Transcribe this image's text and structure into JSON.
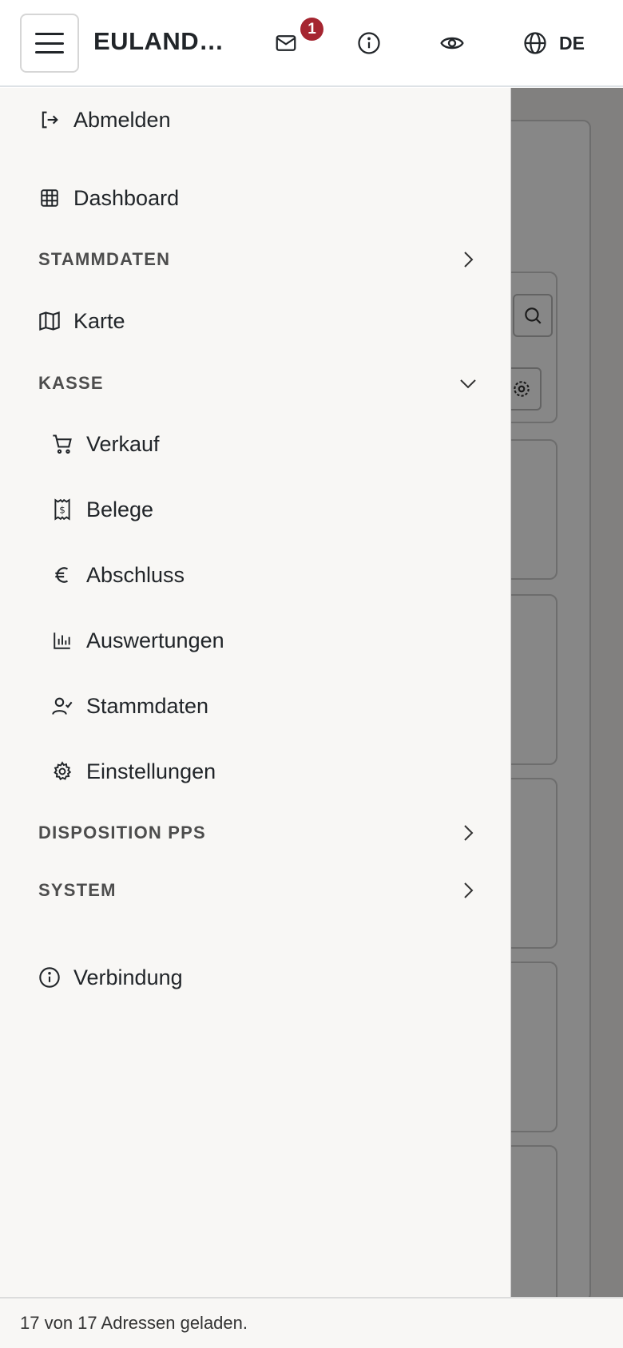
{
  "header": {
    "brand": "EULANDA...",
    "mail_badge": "1",
    "language": "DE"
  },
  "sidebar": {
    "logout_label": "Abmelden",
    "dashboard_label": "Dashboard",
    "sections": {
      "stammdaten": "STAMMDATEN",
      "kasse": "KASSE",
      "disposition": "DISPOSITION PPS",
      "system": "SYSTEM"
    },
    "karte_label": "Karte",
    "kasse_items": [
      {
        "label": "Verkauf",
        "icon": "cart-icon"
      },
      {
        "label": "Belege",
        "icon": "receipt-icon"
      },
      {
        "label": "Abschluss",
        "icon": "euro-icon"
      },
      {
        "label": "Auswertungen",
        "icon": "bar-chart-icon"
      },
      {
        "label": "Stammdaten",
        "icon": "user-check-icon"
      },
      {
        "label": "Einstellungen",
        "icon": "gear-icon"
      }
    ],
    "verbindung_label": "Verbindung"
  },
  "footer": {
    "status": "17 von 17 Adressen geladen."
  },
  "colors": {
    "accent_badge": "#a52530",
    "sidebar_bg": "#f8f7f5",
    "text": "#212529"
  }
}
